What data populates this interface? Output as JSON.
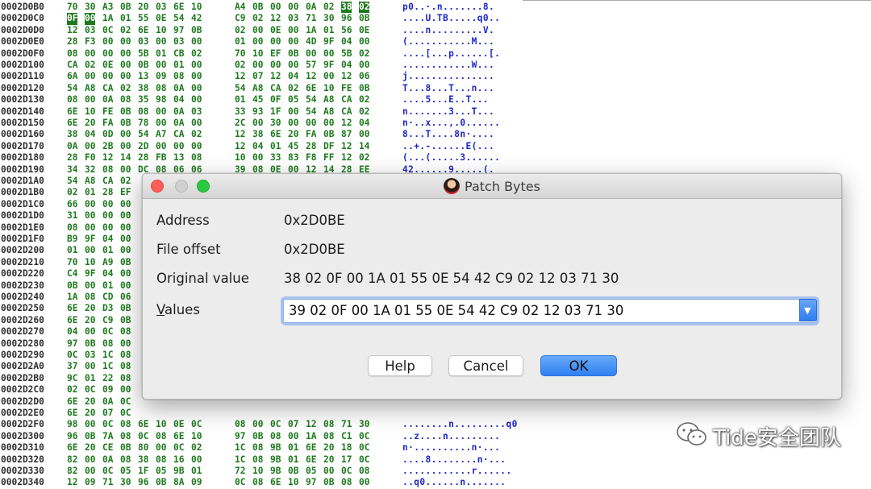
{
  "hex_rows": [
    {
      "addr": "0002D0B0",
      "bytes": [
        "70",
        "30",
        "A3",
        "0B",
        "20",
        "03",
        "6E",
        "10",
        "A4",
        "0B",
        "00",
        "00",
        "0A",
        "02",
        "38",
        "02"
      ],
      "ascii": "p0..·.n.......8."
    },
    {
      "addr": "0002D0C0",
      "bytes": [
        "0F",
        "00",
        "1A",
        "01",
        "55",
        "0E",
        "54",
        "42",
        "C9",
        "02",
        "12",
        "03",
        "71",
        "30",
        "96",
        "0B"
      ],
      "ascii": "....U.TB.....q0.."
    },
    {
      "addr": "0002D0D0",
      "bytes": [
        "12",
        "03",
        "0C",
        "02",
        "6E",
        "10",
        "97",
        "0B",
        "02",
        "00",
        "0E",
        "00",
        "1A",
        "01",
        "56",
        "0E"
      ],
      "ascii": "....n.........V."
    },
    {
      "addr": "0002D0E0",
      "bytes": [
        "28",
        "F3",
        "00",
        "00",
        "03",
        "00",
        "03",
        "00",
        "01",
        "00",
        "00",
        "00",
        "4D",
        "9F",
        "04",
        "00"
      ],
      "ascii": "(...........M..."
    },
    {
      "addr": "0002D0F0",
      "bytes": [
        "08",
        "00",
        "00",
        "00",
        "5B",
        "01",
        "CB",
        "02",
        "70",
        "10",
        "EF",
        "0B",
        "00",
        "00",
        "5B",
        "02"
      ],
      "ascii": "....[...p......[."
    },
    {
      "addr": "0002D100",
      "bytes": [
        "CA",
        "02",
        "0E",
        "00",
        "0B",
        "00",
        "01",
        "00",
        "02",
        "00",
        "00",
        "00",
        "57",
        "9F",
        "04",
        "00"
      ],
      "ascii": "............W..."
    },
    {
      "addr": "0002D110",
      "bytes": [
        "6A",
        "00",
        "00",
        "00",
        "13",
        "09",
        "08",
        "00",
        "12",
        "07",
        "12",
        "04",
        "12",
        "00",
        "12",
        "06"
      ],
      "ascii": "j..............."
    },
    {
      "addr": "0002D120",
      "bytes": [
        "54",
        "A8",
        "CA",
        "02",
        "38",
        "08",
        "0A",
        "00",
        "54",
        "A8",
        "CA",
        "02",
        "6E",
        "10",
        "FE",
        "0B"
      ],
      "ascii": "T...8...T...n..."
    },
    {
      "addr": "0002D130",
      "bytes": [
        "08",
        "00",
        "0A",
        "08",
        "35",
        "98",
        "04",
        "00",
        "01",
        "45",
        "0F",
        "05",
        "54",
        "A8",
        "CA",
        "02"
      ],
      "ascii": "....5...E..T..."
    },
    {
      "addr": "0002D140",
      "bytes": [
        "6E",
        "10",
        "FE",
        "0B",
        "08",
        "00",
        "0A",
        "03",
        "33",
        "93",
        "1F",
        "00",
        "54",
        "A8",
        "CA",
        "02"
      ],
      "ascii": "n.......3...T..."
    },
    {
      "addr": "0002D150",
      "bytes": [
        "6E",
        "20",
        "FA",
        "0B",
        "78",
        "00",
        "0A",
        "00",
        "2C",
        "00",
        "30",
        "00",
        "00",
        "00",
        "12",
        "04"
      ],
      "ascii": "n·..x...,.0......"
    },
    {
      "addr": "0002D160",
      "bytes": [
        "38",
        "04",
        "0D",
        "00",
        "54",
        "A7",
        "CA",
        "02",
        "12",
        "38",
        "6E",
        "20",
        "FA",
        "0B",
        "87",
        "00"
      ],
      "ascii": "8...T....8n·...."
    },
    {
      "addr": "0002D170",
      "bytes": [
        "0A",
        "00",
        "2B",
        "00",
        "2D",
        "00",
        "00",
        "00",
        "12",
        "04",
        "01",
        "45",
        "28",
        "DF",
        "12",
        "14"
      ],
      "ascii": "..+.-......E(..."
    },
    {
      "addr": "0002D180",
      "bytes": [
        "28",
        "F0",
        "12",
        "14",
        "28",
        "FB",
        "13",
        "08",
        "10",
        "00",
        "33",
        "83",
        "F8",
        "FF",
        "12",
        "02"
      ],
      "ascii": "(...(.....3......"
    },
    {
      "addr": "0002D190",
      "bytes": [
        "34",
        "32",
        "08",
        "00",
        "DC",
        "08",
        "06",
        "06",
        "39",
        "08",
        "0E",
        "00",
        "12",
        "14",
        "28",
        "EE"
      ],
      "ascii": "42......9.....(."
    },
    {
      "addr": "0002D1A0",
      "bytes": [
        "54",
        "A8",
        "CA",
        "02"
      ],
      "ascii": ""
    },
    {
      "addr": "0002D1B0",
      "bytes": [
        "02",
        "01",
        "28",
        "EF"
      ],
      "ascii": ""
    },
    {
      "addr": "0002D1C0",
      "bytes": [
        "66",
        "00",
        "00",
        "00"
      ],
      "ascii": ""
    },
    {
      "addr": "0002D1D0",
      "bytes": [
        "31",
        "00",
        "00",
        "00"
      ],
      "ascii": ""
    },
    {
      "addr": "0002D1E0",
      "bytes": [
        "08",
        "00",
        "00",
        "00"
      ],
      "ascii": ""
    },
    {
      "addr": "0002D1F0",
      "bytes": [
        "B9",
        "9F",
        "04",
        "00"
      ],
      "ascii": ""
    },
    {
      "addr": "0002D200",
      "bytes": [
        "01",
        "00",
        "01",
        "00"
      ],
      "ascii": ""
    },
    {
      "addr": "0002D210",
      "bytes": [
        "70",
        "10",
        "A9",
        "0B"
      ],
      "ascii": ""
    },
    {
      "addr": "0002D220",
      "bytes": [
        "C4",
        "9F",
        "04",
        "00"
      ],
      "ascii": ""
    },
    {
      "addr": "0002D230",
      "bytes": [
        "0B",
        "00",
        "01",
        "00"
      ],
      "ascii": ""
    },
    {
      "addr": "0002D240",
      "bytes": [
        "1A",
        "08",
        "CD",
        "06"
      ],
      "ascii": ""
    },
    {
      "addr": "0002D250",
      "bytes": [
        "6E",
        "20",
        "D3",
        "0B"
      ],
      "ascii": ""
    },
    {
      "addr": "0002D260",
      "bytes": [
        "6E",
        "20",
        "C9",
        "0B"
      ],
      "ascii": ""
    },
    {
      "addr": "0002D270",
      "bytes": [
        "04",
        "00",
        "0C",
        "08"
      ],
      "ascii": ""
    },
    {
      "addr": "0002D280",
      "bytes": [
        "97",
        "0B",
        "08",
        "00"
      ],
      "ascii": ""
    },
    {
      "addr": "0002D290",
      "bytes": [
        "0C",
        "03",
        "1C",
        "08"
      ],
      "ascii": ""
    },
    {
      "addr": "0002D2A0",
      "bytes": [
        "37",
        "00",
        "1C",
        "08"
      ],
      "ascii": ""
    },
    {
      "addr": "0002D2B0",
      "bytes": [
        "9C",
        "01",
        "22",
        "08"
      ],
      "ascii": ""
    },
    {
      "addr": "0002D2C0",
      "bytes": [
        "02",
        "0C",
        "09",
        "00"
      ],
      "ascii": ""
    },
    {
      "addr": "0002D2D0",
      "bytes": [
        "6E",
        "20",
        "0A",
        "0C"
      ],
      "ascii": ""
    },
    {
      "addr": "0002D2E0",
      "bytes": [
        "6E",
        "20",
        "07",
        "0C"
      ],
      "ascii": ""
    },
    {
      "addr": "0002D2F0",
      "bytes": [
        "98",
        "00",
        "0C",
        "08",
        "6E",
        "10",
        "0E",
        "0C",
        "08",
        "00",
        "0C",
        "07",
        "12",
        "08",
        "71",
        "30"
      ],
      "ascii": "........n.........q0"
    },
    {
      "addr": "0002D300",
      "bytes": [
        "96",
        "0B",
        "7A",
        "08",
        "0C",
        "08",
        "6E",
        "10",
        "97",
        "0B",
        "08",
        "00",
        "1A",
        "08",
        "C1",
        "0C"
      ],
      "ascii": "..z....n........."
    },
    {
      "addr": "0002D310",
      "bytes": [
        "6E",
        "20",
        "CE",
        "0B",
        "80",
        "00",
        "0C",
        "02",
        "1C",
        "08",
        "9B",
        "01",
        "6E",
        "20",
        "18",
        "0C"
      ],
      "ascii": "n·..........n·..."
    },
    {
      "addr": "0002D320",
      "bytes": [
        "82",
        "00",
        "0A",
        "08",
        "38",
        "08",
        "16",
        "00",
        "1C",
        "08",
        "9B",
        "01",
        "6E",
        "20",
        "17",
        "0C"
      ],
      "ascii": "....8........n·..."
    },
    {
      "addr": "0002D330",
      "bytes": [
        "82",
        "00",
        "0C",
        "05",
        "1F",
        "05",
        "9B",
        "01",
        "72",
        "10",
        "9B",
        "0B",
        "05",
        "00",
        "0C",
        "08"
      ],
      "ascii": "............r......"
    },
    {
      "addr": "0002D340",
      "bytes": [
        "12",
        "09",
        "71",
        "30",
        "96",
        "0B",
        "8A",
        "09",
        "0C",
        "08",
        "6E",
        "10",
        "97",
        "0B",
        "08",
        "00"
      ],
      "ascii": "..q0......n......."
    }
  ],
  "dialog": {
    "title": "Patch Bytes",
    "address_label": "Address",
    "address_value": "0x2D0BE",
    "file_offset_label": "File offset",
    "file_offset_value": "0x2D0BE",
    "original_label": "Original value",
    "original_value": "38 02 0F 00 1A 01 55 0E 54 42 C9 02 12 03 71 30",
    "values_label": "Values",
    "values_value": "39 02 0F 00 1A 01 55 0E 54 42 C9 02 12 03 71 30",
    "help_label": "Help",
    "cancel_label": "Cancel",
    "ok_label": "OK"
  },
  "watermark": {
    "text": "Tide安全团队"
  },
  "icons": [
    "close-icon",
    "minimize-icon",
    "zoom-icon",
    "app-icon",
    "chevron-down-icon",
    "wechat-icon"
  ],
  "colors": {
    "hex_bytes": "#1e7a1e",
    "ascii": "#1c28c8",
    "highlight": "#1f7a1f",
    "ok_button": "#2f80f2",
    "close": "#fc5f57",
    "zoom": "#2ac941"
  }
}
